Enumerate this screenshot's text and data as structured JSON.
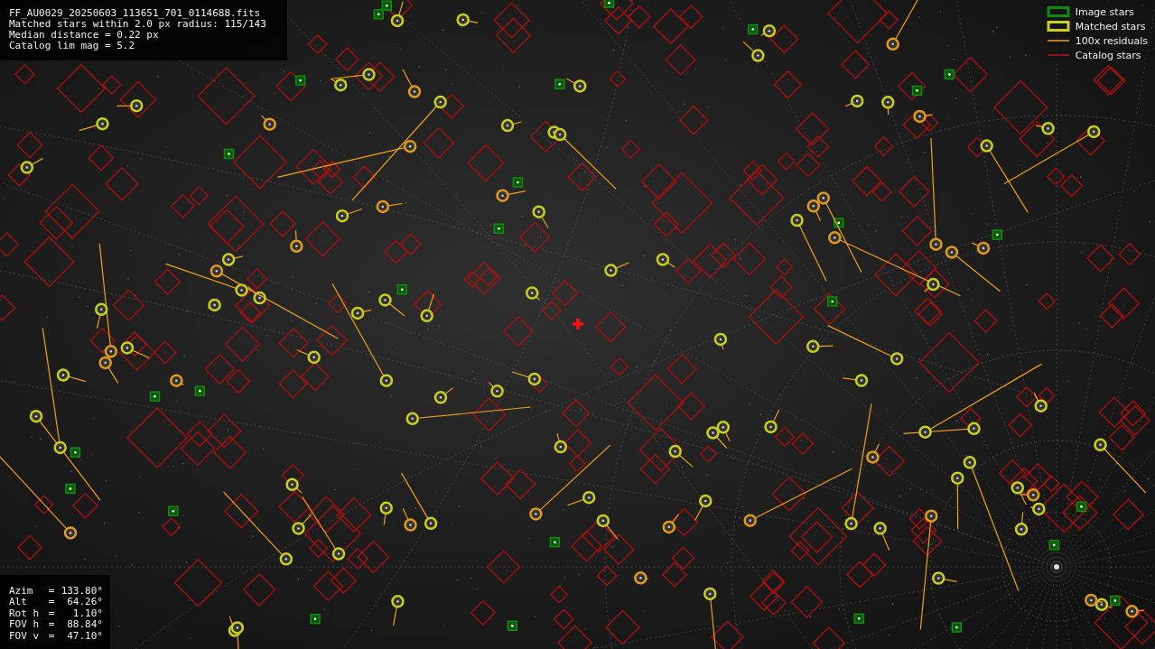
{
  "info_box": {
    "lines": [
      "FF_AU0029_20250603_113651_701_0114688.fits",
      "Matched stars within 2.0 px radius: 115/143",
      "Median distance = 0.22 px",
      "Catalog lim mag = 5.2"
    ]
  },
  "legend": [
    {
      "kind": "image",
      "label": "Image stars"
    },
    {
      "kind": "matched",
      "label": "Matched stars"
    },
    {
      "kind": "residual",
      "label": "100x residuals"
    },
    {
      "kind": "catalog",
      "label": "Catalog stars"
    }
  ],
  "pointing": [
    {
      "label": "Azim",
      "separator": "=",
      "value": "133.80°"
    },
    {
      "label": "Alt",
      "separator": "=",
      "value": "64.26°"
    },
    {
      "label": "Rot h",
      "separator": "=",
      "value": "1.10°"
    },
    {
      "label": "FOV h",
      "separator": "=",
      "value": "88.84°"
    },
    {
      "label": "FOV v",
      "separator": "=",
      "value": "47.10°"
    }
  ]
}
